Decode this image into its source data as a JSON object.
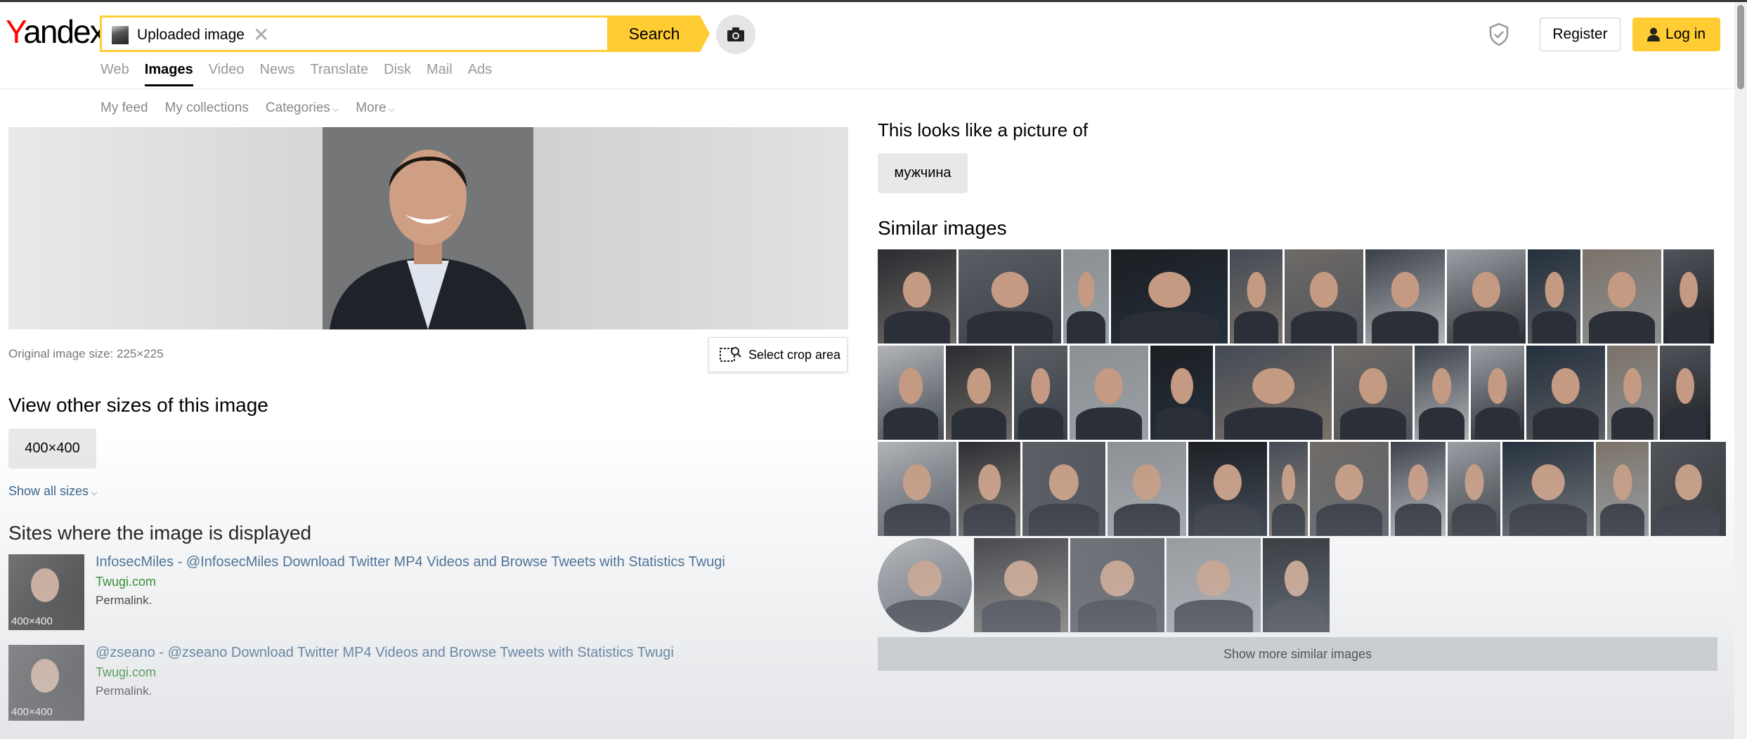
{
  "header": {
    "logo": {
      "first_letter": "Y",
      "rest": "andex"
    },
    "search": {
      "chip_label": "Uploaded image",
      "value": "",
      "button_label": "Search"
    },
    "register_label": "Register",
    "login_label": "Log in",
    "nav": [
      {
        "label": "Web",
        "active": false
      },
      {
        "label": "Images",
        "active": true
      },
      {
        "label": "Video",
        "active": false
      },
      {
        "label": "News",
        "active": false
      },
      {
        "label": "Translate",
        "active": false
      },
      {
        "label": "Disk",
        "active": false
      },
      {
        "label": "Mail",
        "active": false
      },
      {
        "label": "Ads",
        "active": false
      }
    ],
    "subnav": [
      {
        "label": "My feed",
        "dropdown": false
      },
      {
        "label": "My collections",
        "dropdown": false
      },
      {
        "label": "Categories",
        "dropdown": true
      },
      {
        "label": "More",
        "dropdown": true
      }
    ]
  },
  "left": {
    "original_size": "Original image size: 225×225",
    "crop_button": "Select crop area",
    "sizes_heading": "View other sizes of this image",
    "size_button": "400×400",
    "show_all_sizes": "Show all sizes",
    "sites_heading": "Sites where the image is displayed",
    "sites": [
      {
        "title": "InfosecMiles - @InfosecMiles Download Twitter MP4 Videos and Browse Tweets with Statistics Twugi",
        "domain": "Twugi.com",
        "permalink": "Permalink.",
        "thumb_label": "400×400"
      },
      {
        "title": "@zseano - @zseano Download Twitter MP4 Videos and Browse Tweets with Statistics Twugi",
        "domain": "Twugi.com",
        "permalink": "Permalink.",
        "thumb_label": "400×400"
      }
    ]
  },
  "right": {
    "looks_like": "This looks like a picture of",
    "tag": "мужчина",
    "similar_heading": "Similar images",
    "show_more": "Show more similar images"
  },
  "colors": {
    "accent_yellow": "#ffcc33",
    "logo_red": "#ff0000",
    "link_blue": "#2a5885",
    "domain_green": "#007700"
  },
  "icons": [
    "close-icon",
    "camera-icon",
    "shield-icon",
    "user-icon",
    "chevron-down-icon",
    "crop-search-icon"
  ]
}
